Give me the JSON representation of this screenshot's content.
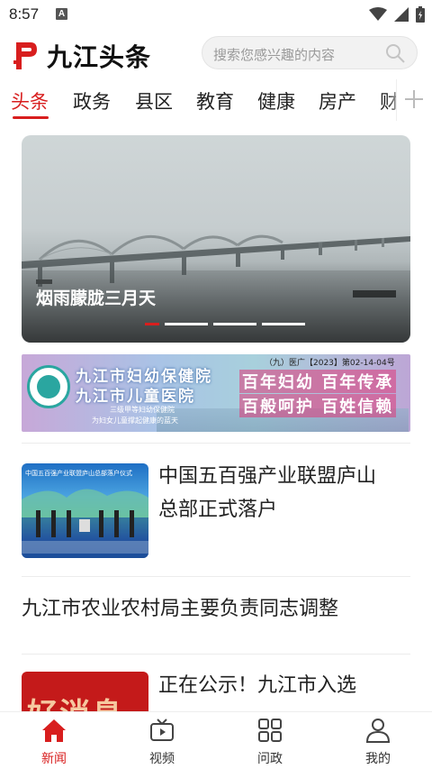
{
  "status_bar": {
    "time": "8:57",
    "notification_badge": "A",
    "icons": [
      "wifi-icon",
      "signal-icon",
      "battery-icon"
    ]
  },
  "header": {
    "app_name": "九江头条",
    "search_placeholder": "搜索您感兴趣的内容",
    "brand_color": "#d81e1e"
  },
  "tabs": {
    "items": [
      "头条",
      "政务",
      "县区",
      "教育",
      "健康",
      "房产",
      "财"
    ],
    "active": "头条"
  },
  "carousel": {
    "caption": "烟雨朦胧三月天",
    "slide_count": 4,
    "active_index": 0
  },
  "banner": {
    "hospital_name_1": "九江市妇幼保健院",
    "hospital_name_2": "九江市儿童医院",
    "subtitle_1": "三级甲等妇幼保健院",
    "subtitle_2": "为妇女儿童撑起健康的蓝天",
    "registration": "（九）医广【2023】第02-14-04号",
    "slogan_1": "百年妇幼 百年传承",
    "slogan_2": "百般呵护 百姓信赖"
  },
  "news": [
    {
      "title_line1": "中国五百强产业联盟庐山",
      "title_line2": "总部正式落户",
      "thumb_caption": "中国五百强产业联盟庐山总部落户仪式"
    },
    {
      "title": "九江市农业农村局主要负责同志调整"
    },
    {
      "title_line1": "正在公示！九江市入选",
      "thumb_text": "好消息"
    }
  ],
  "bottom_nav": {
    "items": [
      {
        "label": "新闻",
        "icon": "home-icon"
      },
      {
        "label": "视频",
        "icon": "tv-icon"
      },
      {
        "label": "问政",
        "icon": "grid-icon"
      },
      {
        "label": "我的",
        "icon": "person-icon"
      }
    ],
    "active": "新闻"
  }
}
